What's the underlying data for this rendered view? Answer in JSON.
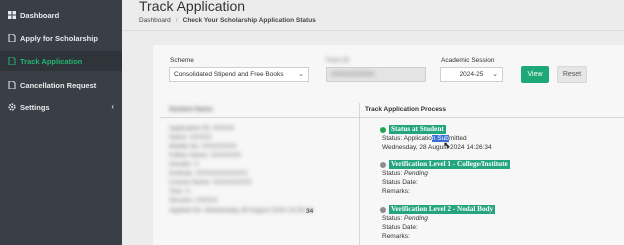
{
  "sidebar": {
    "items": [
      {
        "label": "Dashboard",
        "icon": "dashboard-icon",
        "active": false
      },
      {
        "label": "Apply for Scholarship",
        "icon": "document-icon",
        "active": false
      },
      {
        "label": "Track Application",
        "icon": "document-icon",
        "active": true
      },
      {
        "label": "Cancellation Request",
        "icon": "document-icon",
        "active": false
      },
      {
        "label": "Settings",
        "icon": "gear-icon",
        "active": false,
        "chevron": "‹"
      }
    ]
  },
  "header": {
    "title": "Track Application",
    "breadcrumb": {
      "home": "Dashboard",
      "separator": "/",
      "current": "Check Your Scholarship Application Status"
    }
  },
  "filters": {
    "scheme_label": "Scheme",
    "scheme_value": "Consolidated Stipend and Free Books",
    "blurred_label": "Form ID",
    "blurred_value": "XXXXXXXXXX",
    "session_label": "Academic Session",
    "session_value": "2024-25",
    "view_label": "View",
    "reset_label": "Reset"
  },
  "table": {
    "col1_header": "Student Name",
    "col2_header": "Track Application Process",
    "blurred_details": [
      "Application ID: XXXXX",
      "Name: XXXXX",
      "Mobile No: XXXXXXXX",
      "Father Name: XXXXXXX",
      "Gender: X",
      "Institute: XXXXXXXXXXXX",
      "Course Name: XXXXXXXXX",
      "Year: X",
      "Session: XXXXX",
      "Applied On: Wednesday 28 August 2024 14:26:34"
    ],
    "blurred_trailing": "34"
  },
  "process": {
    "steps": [
      {
        "title": "Status at Student",
        "status_prefix": "Status: Applicatio",
        "status_highlight": "n Sub",
        "status_suffix": "mitted",
        "date": "Wednesday, 28 August 2024 14:26:34",
        "done": true
      },
      {
        "title": "Verification Level 1 - College/Institute",
        "status_label": "Status:",
        "status_value": "Pending",
        "date_label": "Status Date:",
        "remarks_label": "Remarks:",
        "done": false
      },
      {
        "title": "Verification Level 2 - Nodal Body",
        "status_label": "Status:",
        "status_value": "Pending",
        "date_label": "Status Date:",
        "remarks_label": "Remarks:",
        "done": false
      }
    ]
  },
  "colors": {
    "accent": "#1fa877",
    "sidebar_bg": "#3a3f47",
    "active_text": "#22b573"
  }
}
